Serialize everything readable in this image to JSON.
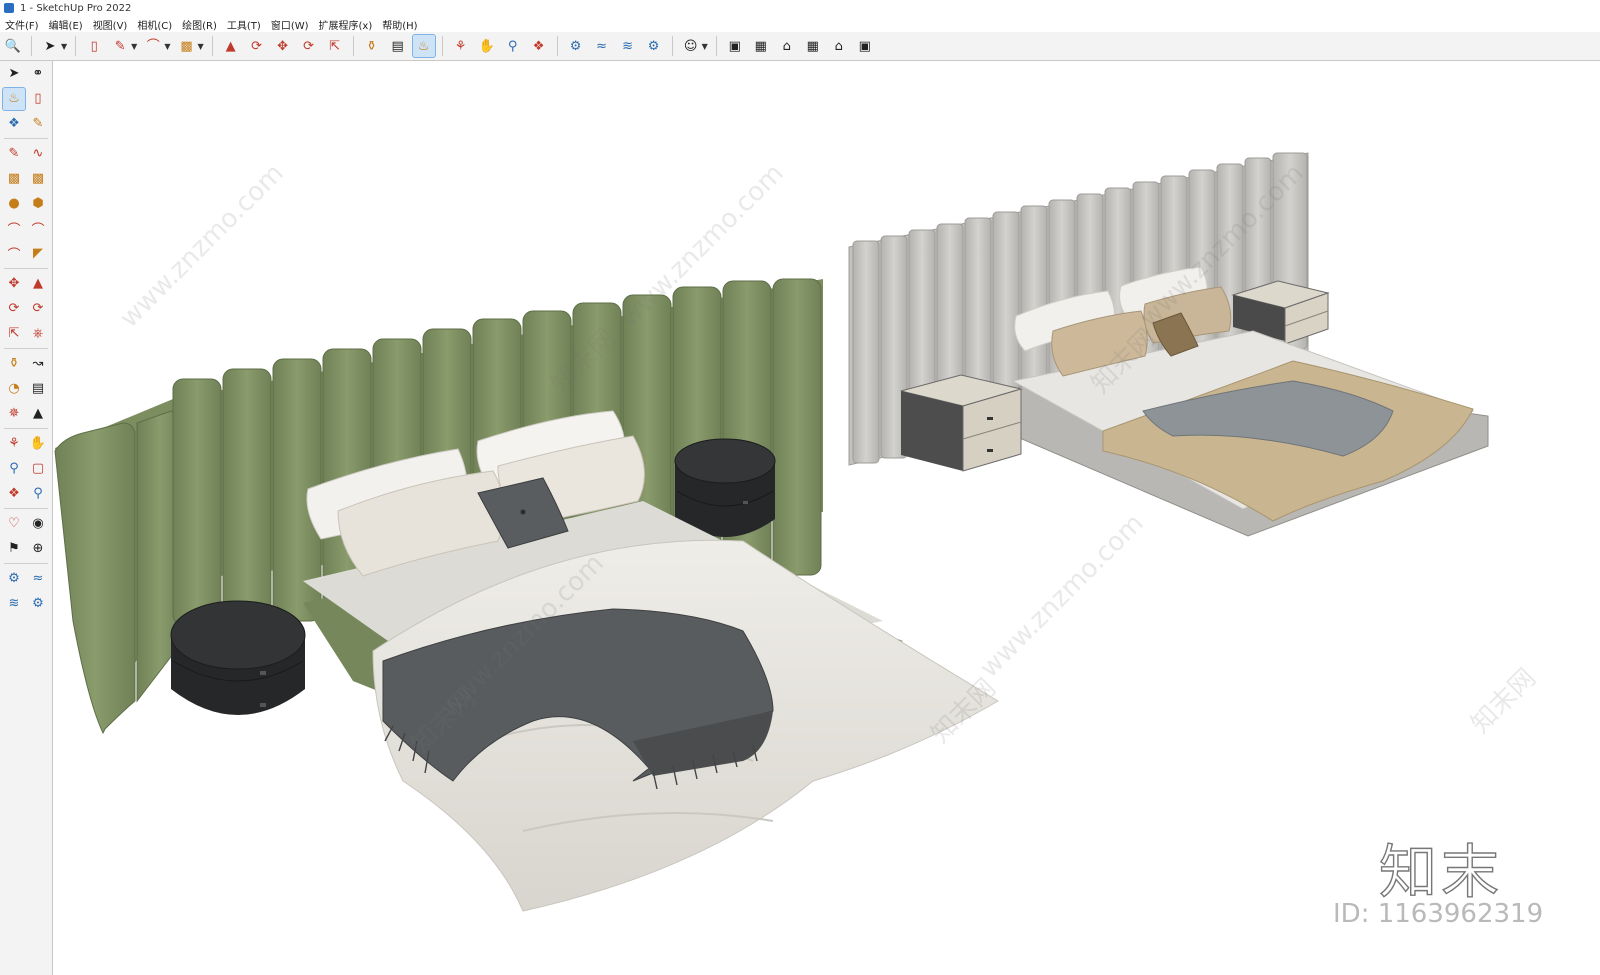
{
  "window": {
    "title": "1 - SketchUp Pro 2022"
  },
  "menu": [
    "文件(F)",
    "编辑(E)",
    "视图(V)",
    "相机(C)",
    "绘图(R)",
    "工具(T)",
    "窗口(W)",
    "扩展程序(x)",
    "帮助(H)"
  ],
  "watermark": {
    "site": "www.znzmo.com",
    "brand": "知末网",
    "logo": "知末",
    "id": "ID: 1163962319"
  },
  "colors": {
    "green_headboard": "#7f9163",
    "grey_headboard": "#c5c4c0",
    "bedding_white": "#e9e7e2",
    "throw_dark": "#55585a",
    "nightstand_black": "#2a2b2d",
    "pillow_beige": "#c9b79a"
  }
}
